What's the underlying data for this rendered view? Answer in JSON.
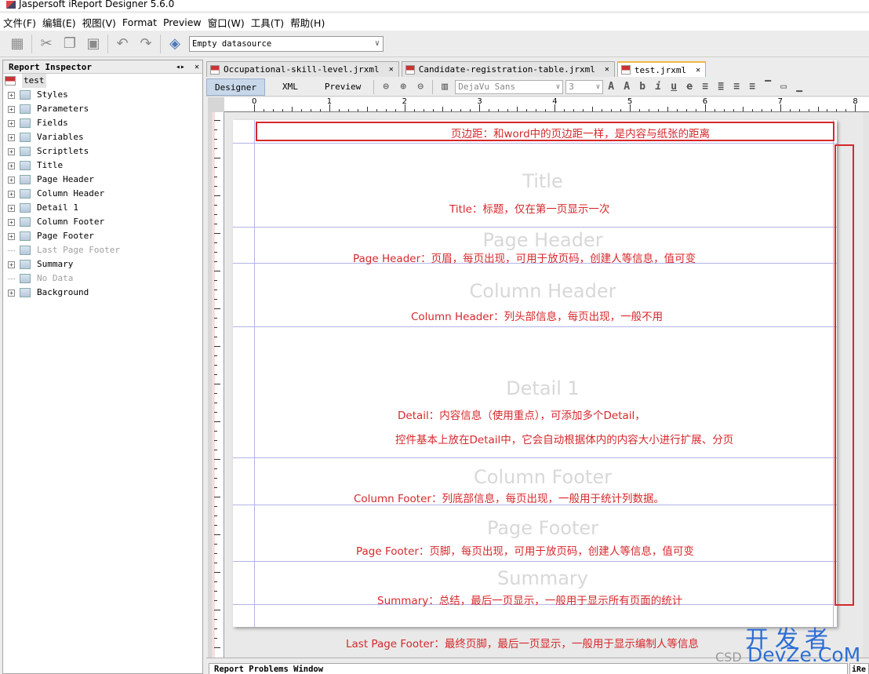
{
  "window": {
    "title": "Jaspersoft iReport Designer 5.6.0"
  },
  "menu": [
    "文件(F)",
    "编辑(E)",
    "视图(V)",
    "Format",
    "Preview",
    "窗口(W)",
    "工具(T)",
    "帮助(H)"
  ],
  "toolbar": {
    "datasource": "Empty datasource"
  },
  "inspector": {
    "title": "Report Inspector",
    "root": "test",
    "items": [
      {
        "label": "Styles",
        "expandable": true,
        "enabled": true
      },
      {
        "label": "Parameters",
        "expandable": true,
        "enabled": true
      },
      {
        "label": "Fields",
        "expandable": true,
        "enabled": true
      },
      {
        "label": "Variables",
        "expandable": true,
        "enabled": true
      },
      {
        "label": "Scriptlets",
        "expandable": true,
        "enabled": true
      },
      {
        "label": "Title",
        "expandable": true,
        "enabled": true
      },
      {
        "label": "Page Header",
        "expandable": true,
        "enabled": true
      },
      {
        "label": "Column Header",
        "expandable": true,
        "enabled": true
      },
      {
        "label": "Detail 1",
        "expandable": true,
        "enabled": true
      },
      {
        "label": "Column Footer",
        "expandable": true,
        "enabled": true
      },
      {
        "label": "Page Footer",
        "expandable": true,
        "enabled": true
      },
      {
        "label": "Last Page Footer",
        "expandable": false,
        "enabled": false
      },
      {
        "label": "Summary",
        "expandable": true,
        "enabled": true
      },
      {
        "label": "No Data",
        "expandable": false,
        "enabled": false
      },
      {
        "label": "Background",
        "expandable": true,
        "enabled": true
      }
    ]
  },
  "tabs": [
    {
      "label": "Occupational-skill-level.jrxml",
      "active": false
    },
    {
      "label": "Candidate-registration-table.jrxml",
      "active": false
    },
    {
      "label": "test.jrxml",
      "active": true
    }
  ],
  "views": [
    "Designer",
    "XML",
    "Preview"
  ],
  "format": {
    "font": "DejaVu Sans",
    "size": "3"
  },
  "ruler": [
    "0",
    "1",
    "2",
    "3",
    "4",
    "5",
    "6",
    "7",
    "8"
  ],
  "bands": {
    "title": "Title",
    "page_header": "Page Header",
    "column_header": "Column Header",
    "detail": "Detail 1",
    "column_footer": "Column Footer",
    "page_footer": "Page Footer",
    "summary": "Summary"
  },
  "notes": {
    "margin": "页边距：和word中的页边距一样，是内容与纸张的距离",
    "title": "Title：标题，仅在第一页显示一次",
    "page_header": "Page Header：页眉，每页出现，可用于放页码，创建人等信息，值可变",
    "column_header": "Column Header：列头部信息，每页出现，一般不用",
    "detail1": "Detail：内容信息（使用重点），可添加多个Detail，",
    "detail2": "控件基本上放在Detail中，它会自动根据体内的内容大小进行扩展、分页",
    "column_footer": "Column Footer：列底部信息，每页出现，一般用于统计列数据。",
    "page_footer": "Page Footer：页脚，每页出现，可用于放页码，创建人等信息，值可变",
    "summary": "Summary：总结，最后一页显示，一般用于显示所有页面的统计",
    "last_page_footer": "Last Page Footer：最终页脚，最后一页显示，一般用于显示编制人等信息"
  },
  "bottom": {
    "problems": "Report Problems Window",
    "right": "iRe"
  },
  "watermark": {
    "cn": "开发者",
    "en": "DevZe.CoM",
    "csdn": "CSD"
  },
  "colors": {
    "annotation": "#d6282c",
    "band_line": "#b3b3e6",
    "watermark": "#2d6ed3"
  }
}
